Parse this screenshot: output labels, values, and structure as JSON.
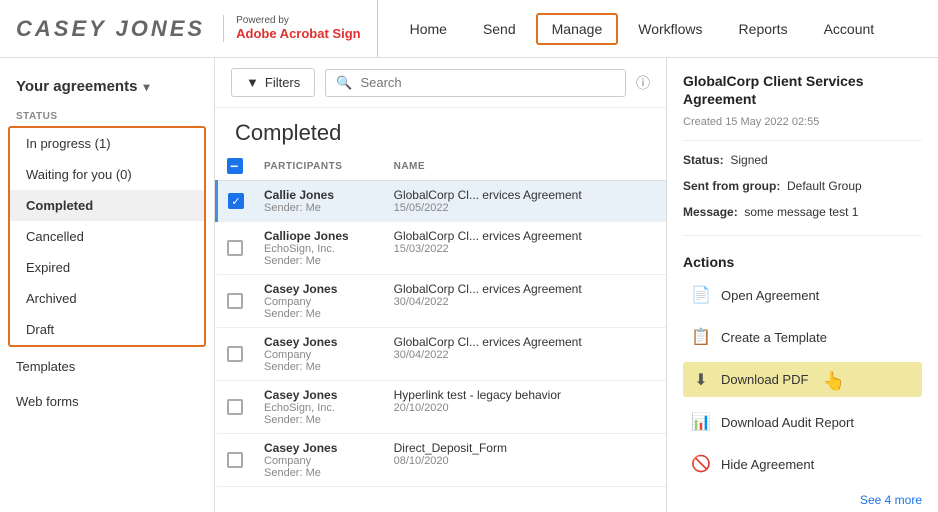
{
  "header": {
    "logo_name": "Casey Jones",
    "powered_by": "Powered by",
    "adobe_brand": "Adobe Acrobat Sign",
    "nav_items": [
      {
        "label": "Home",
        "active": false
      },
      {
        "label": "Send",
        "active": false
      },
      {
        "label": "Manage",
        "active": true
      },
      {
        "label": "Workflows",
        "active": false
      },
      {
        "label": "Reports",
        "active": false
      },
      {
        "label": "Account",
        "active": false
      }
    ]
  },
  "sidebar": {
    "header_label": "Your agreements",
    "status_section_label": "STATUS",
    "status_items": [
      {
        "label": "In progress (1)",
        "active": false
      },
      {
        "label": "Waiting for you (0)",
        "active": false
      },
      {
        "label": "Completed",
        "active": true
      },
      {
        "label": "Cancelled",
        "active": false
      },
      {
        "label": "Expired",
        "active": false
      },
      {
        "label": "Archived",
        "active": false
      },
      {
        "label": "Draft",
        "active": false
      }
    ],
    "extra_items": [
      {
        "label": "Templates"
      },
      {
        "label": "Web forms"
      }
    ]
  },
  "content": {
    "filters_label": "Filters",
    "search_placeholder": "Search",
    "section_title": "Completed",
    "table": {
      "columns": [
        "",
        "PARTICIPANTS",
        "NAME",
        ""
      ],
      "rows": [
        {
          "checked": true,
          "participant_name": "Callie Jones",
          "participant_sub": "Sender: Me",
          "doc_name": "GlobalCorp Cl... ervices Agreement",
          "doc_date": "15/05/2022",
          "selected": true
        },
        {
          "checked": false,
          "participant_name": "Calliope Jones",
          "participant_sub": "EchoSign, Inc.\nSender: Me",
          "doc_name": "GlobalCorp Cl... ervices Agreement",
          "doc_date": "15/03/2022",
          "selected": false
        },
        {
          "checked": false,
          "participant_name": "Casey Jones",
          "participant_sub": "Company\nSender: Me",
          "doc_name": "GlobalCorp Cl... ervices Agreement",
          "doc_date": "30/04/2022",
          "selected": false
        },
        {
          "checked": false,
          "participant_name": "Casey Jones",
          "participant_sub": "Company\nSender: Me",
          "doc_name": "GlobalCorp Cl... ervices Agreement",
          "doc_date": "30/04/2022",
          "selected": false
        },
        {
          "checked": false,
          "participant_name": "Casey Jones",
          "participant_sub": "EchoSign, Inc.\nSender: Me",
          "doc_name": "Hyperlink test - legacy behavior",
          "doc_date": "20/10/2020",
          "selected": false
        },
        {
          "checked": false,
          "participant_name": "Casey Jones",
          "participant_sub": "Company\nSender: Me",
          "doc_name": "Direct_Deposit_Form",
          "doc_date": "08/10/2020",
          "selected": false
        }
      ]
    }
  },
  "right_panel": {
    "title": "GlobalCorp Client Services Agreement",
    "created": "Created 15 May 2022 02:55",
    "status_label": "Status:",
    "status_value": "Signed",
    "sent_from_label": "Sent from group:",
    "sent_from_value": "Default Group",
    "message_label": "Message:",
    "message_value": "some message test 1",
    "actions_title": "Actions",
    "actions": [
      {
        "label": "Open Agreement",
        "icon": "📄"
      },
      {
        "label": "Create a Template",
        "icon": "📋"
      },
      {
        "label": "Download PDF",
        "icon": "⬇",
        "highlighted": true
      },
      {
        "label": "Download Audit Report",
        "icon": "📊"
      },
      {
        "label": "Hide Agreement",
        "icon": "🚫"
      }
    ],
    "see_more": "See 4 more"
  }
}
